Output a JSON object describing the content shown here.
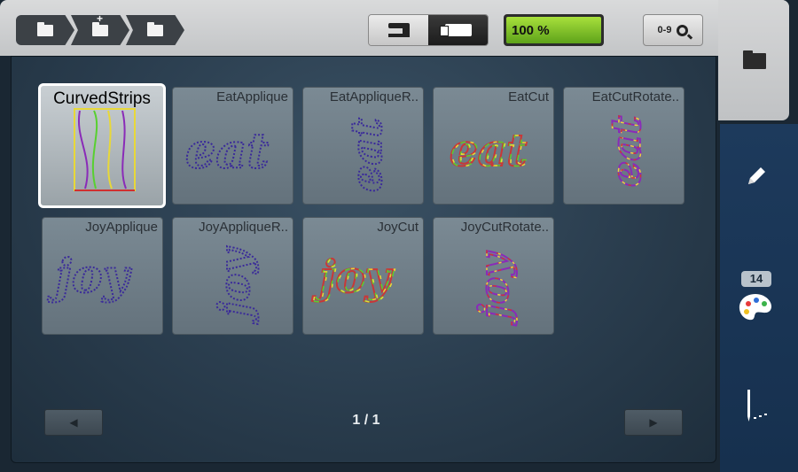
{
  "breadcrumb": {
    "items": [
      {
        "icon": "folder-icon"
      },
      {
        "icon": "folder-plus-icon"
      },
      {
        "icon": "folder-icon"
      }
    ]
  },
  "view_toggle": {
    "options": [
      {
        "icon": "sewing-machine-icon",
        "selected": false
      },
      {
        "icon": "embroidery-card-icon",
        "selected": true
      }
    ]
  },
  "zoom": {
    "label": "100 %"
  },
  "find": {
    "label": "0-9",
    "icon": "search-icon"
  },
  "sidebar": {
    "top_icon": "folder-icon",
    "items": [
      {
        "icon": "pencil-icon"
      },
      {
        "icon": "palette-icon",
        "badge": "14"
      },
      {
        "icon": "needle-icon"
      }
    ]
  },
  "designs": [
    {
      "name": "CurvedStrips",
      "selected": true
    },
    {
      "name": "EatApplique",
      "selected": false
    },
    {
      "name": "EatAppliqueR..",
      "selected": false
    },
    {
      "name": "EatCut",
      "selected": false
    },
    {
      "name": "EatCutRotate..",
      "selected": false
    },
    {
      "name": "JoyApplique",
      "selected": false
    },
    {
      "name": "JoyAppliqueR..",
      "selected": false
    },
    {
      "name": "JoyCut",
      "selected": false
    },
    {
      "name": "JoyCutRotate..",
      "selected": false
    }
  ],
  "pager": {
    "text": "1 / 1"
  },
  "colors": {
    "accent_green": "#7cc42a",
    "sidebar_blue": "#1d3a5c"
  }
}
